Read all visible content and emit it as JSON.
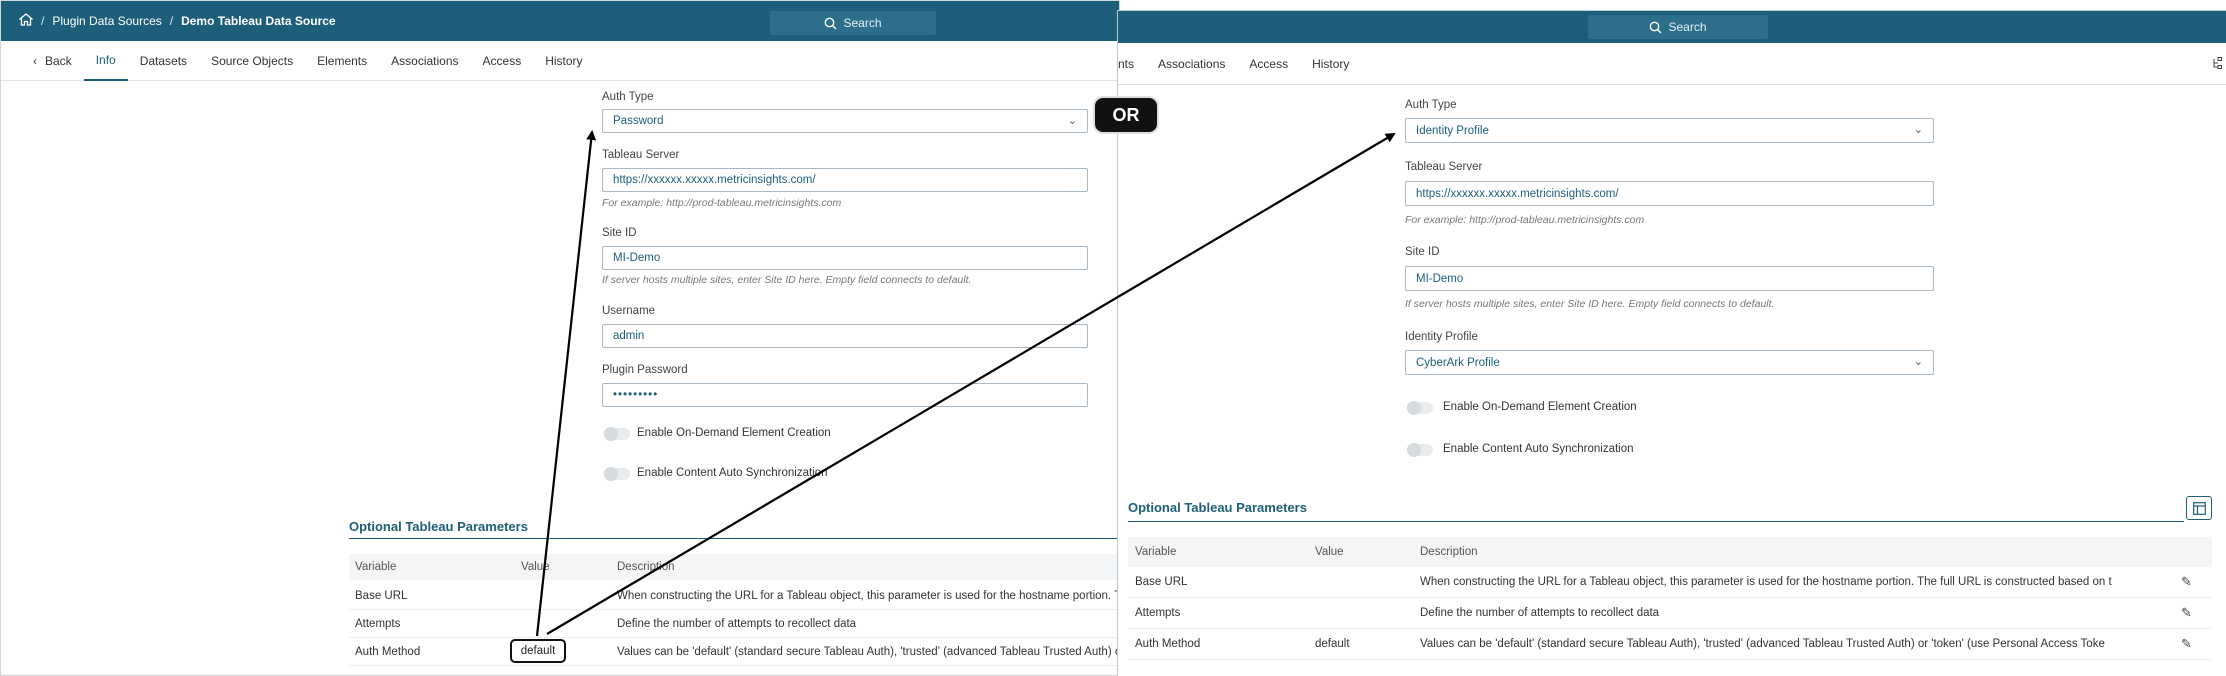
{
  "left": {
    "breadcrumb": {
      "sep": "/",
      "item1": "Plugin Data Sources",
      "item2": "Demo Tableau Data Source"
    },
    "search_label": "Search",
    "tabs": [
      "Back",
      "Info",
      "Datasets",
      "Source Objects",
      "Elements",
      "Associations",
      "Access",
      "History"
    ],
    "form": {
      "auth_type_label": "Auth Type",
      "auth_type_value": "Password",
      "server_label": "Tableau Server",
      "server_value": "https://xxxxxx.xxxxx.metricinsights.com/",
      "server_hint": "For example: http://prod-tableau.metricinsights.com",
      "site_label": "Site ID",
      "site_value": "MI-Demo",
      "site_hint": "If server hosts multiple sites, enter Site ID here. Empty field connects to default.",
      "username_label": "Username",
      "username_value": "admin",
      "password_label": "Plugin Password",
      "password_value": "•••••••••",
      "toggle1": "Enable On-Demand Element Creation",
      "toggle2": "Enable Content Auto Synchronization"
    },
    "optional": {
      "title": "Optional Tableau Parameters",
      "headers": [
        "Variable",
        "Value",
        "Description"
      ],
      "rows": [
        {
          "variable": "Base URL",
          "value": "",
          "description": "When constructing the URL for a Tableau object, this parameter is used for the hostname portion. Th"
        },
        {
          "variable": "Attempts",
          "value": "",
          "description": "Define the number of attempts to recollect data"
        },
        {
          "variable": "Auth Method",
          "value": "default",
          "description": "Values can be 'default' (standard secure Tableau Auth), 'trusted' (advanced Tableau Trusted Auth) o"
        }
      ]
    }
  },
  "right": {
    "search_label": "Search",
    "tabs": [
      "nts",
      "Associations",
      "Access",
      "History"
    ],
    "form": {
      "auth_type_label": "Auth Type",
      "auth_type_value": "Identity Profile",
      "server_label": "Tableau Server",
      "server_value": "https://xxxxxx.xxxxx.metricinsights.com/",
      "server_hint": "For example: http://prod-tableau.metricinsights.com",
      "site_label": "Site ID",
      "site_value": "MI-Demo",
      "site_hint": "If server hosts multiple sites, enter Site ID here. Empty field connects to default.",
      "profile_label": "Identity Profile",
      "profile_value": "CyberArk Profile",
      "toggle1": "Enable On-Demand Element Creation",
      "toggle2": "Enable Content Auto Synchronization"
    },
    "optional": {
      "title": "Optional Tableau Parameters",
      "headers": [
        "Variable",
        "Value",
        "Description"
      ],
      "rows": [
        {
          "variable": "Base URL",
          "value": "",
          "description": "When constructing the URL for a Tableau object, this parameter is used for the hostname portion. The full URL is constructed based on t"
        },
        {
          "variable": "Attempts",
          "value": "",
          "description": "Define the number of attempts to recollect data"
        },
        {
          "variable": "Auth Method",
          "value": "default",
          "description": "Values can be 'default' (standard secure Tableau Auth), 'trusted' (advanced Tableau Trusted Auth) or 'token' (use Personal Access Toke"
        }
      ]
    }
  },
  "annotations": {
    "or_label": "OR",
    "highlight_value": "default"
  },
  "colors": {
    "header": "#1d5f7a",
    "accent": "#1d5f7a"
  }
}
